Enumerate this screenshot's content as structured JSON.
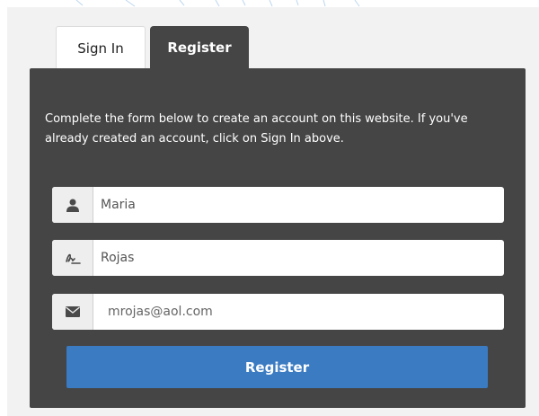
{
  "tabs": {
    "signin_label": "Sign In",
    "register_label": "Register"
  },
  "form": {
    "intro": "Complete the form below to create an account on this website. If you've already created an account, click on Sign In above.",
    "first_name": {
      "value": "Maria",
      "icon": "user-icon"
    },
    "last_name": {
      "value": "Rojas",
      "icon": "signature-icon"
    },
    "email": {
      "value": "mrojas@aol.com",
      "icon": "envelope-icon"
    },
    "submit_label": "Register"
  },
  "colors": {
    "panel": "#454545",
    "button": "#3a7bc2",
    "tab_active_text": "#ffffff",
    "page_background": "#f2f2f2"
  }
}
